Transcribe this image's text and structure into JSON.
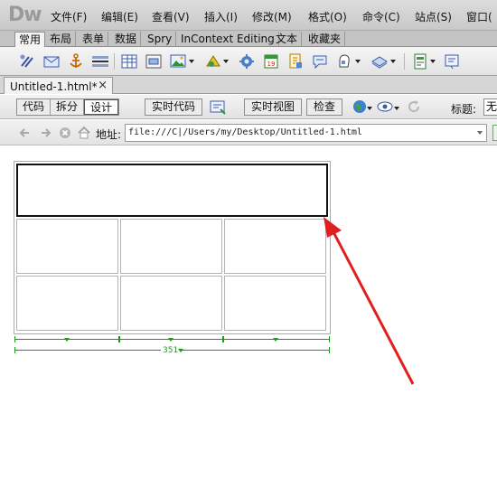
{
  "app": {
    "logo": "Dw"
  },
  "menu": [
    "文件(F)",
    "编辑(E)",
    "查看(V)",
    "插入(I)",
    "修改(M)",
    "格式(O)",
    "命令(C)",
    "站点(S)",
    "窗口("
  ],
  "insert_tabs": [
    "常用",
    "布局",
    "表单",
    "数据",
    "Spry",
    "InContext Editing",
    "文本",
    "收藏夹"
  ],
  "insert_tools": [
    "hyperlink-icon",
    "email-link-icon",
    "named-anchor-icon",
    "horizontal-rule-icon",
    "table-icon",
    "insert-div-icon",
    "image-icon",
    "media-icon",
    "widget-icon",
    "date-icon",
    "server-include-icon",
    "comment-icon",
    "head-icon",
    "script-icon",
    "templates-icon",
    "tag-chooser-icon"
  ],
  "document": {
    "tab_label": "Untitled-1.html*",
    "close_symbol": "×"
  },
  "doc_toolbar": {
    "code": "代码",
    "split": "拆分",
    "design": "设计",
    "live_code": "实时代码",
    "live_view": "实时视图",
    "inspect": "检查",
    "title_label": "标题:",
    "title_value": "无"
  },
  "address": {
    "label": "地址:",
    "value": "file:///C|/Users/my/Desktop/Untitled-1.html"
  },
  "design_table": {
    "rows": 3,
    "columns": 3,
    "first_row_merged": true,
    "total_width_label": "351"
  },
  "colors": {
    "width_guides": "#1a9a1a",
    "annotation_arrow": "#e02020",
    "menubar": "#d0d0d0"
  }
}
